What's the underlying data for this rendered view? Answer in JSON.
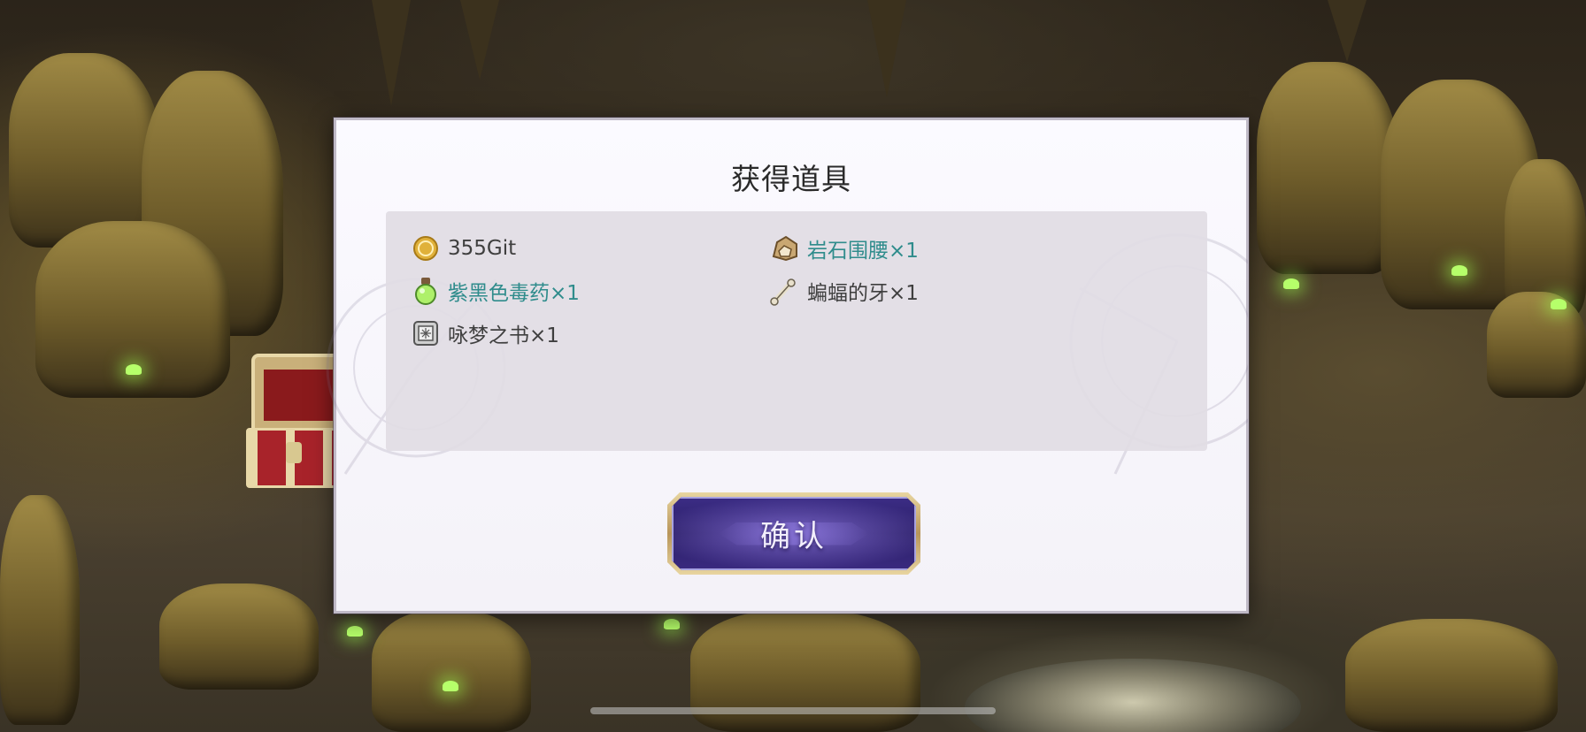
{
  "dialog": {
    "title": "获得道具",
    "confirm_label": "确认"
  },
  "items": [
    {
      "name": "355Git",
      "icon": "gold-coin-icon",
      "color": "#3f3f3f"
    },
    {
      "name": "岩石围腰×1",
      "icon": "rock-belt-icon",
      "color": "#2f8c8c"
    },
    {
      "name": "紫黑色毒药×1",
      "icon": "potion-icon",
      "color": "#2f8c8c"
    },
    {
      "name": "蝙蝠的牙×1",
      "icon": "bone-tooth-icon",
      "color": "#3f3f3f"
    },
    {
      "name": "咏梦之书×1",
      "icon": "book-icon",
      "color": "#3f3f3f"
    }
  ],
  "colors": {
    "rare_item_text": "#2f8c8c",
    "normal_item_text": "#3f3f3f",
    "button_fill": "#2a1e66",
    "button_border": "#e8d5a0"
  }
}
